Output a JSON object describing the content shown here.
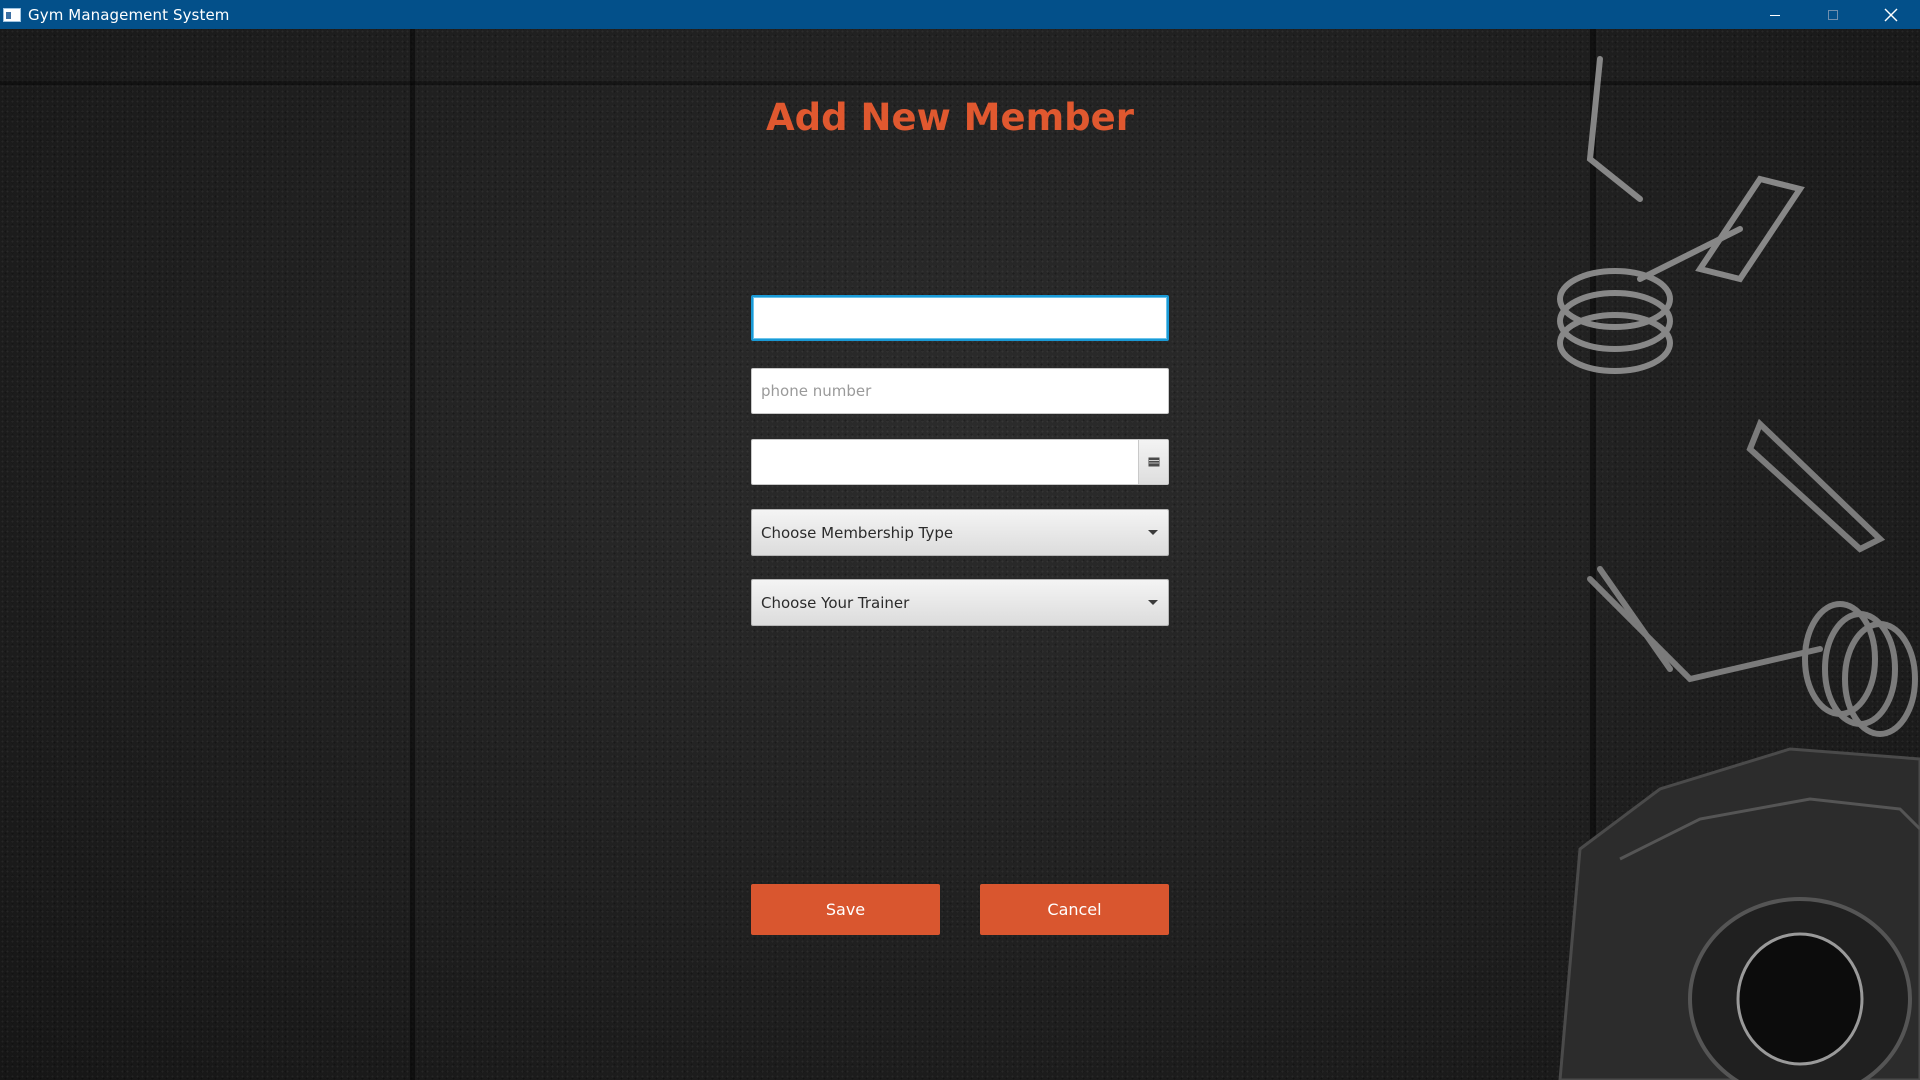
{
  "window": {
    "title": "Gym Management System"
  },
  "form": {
    "heading": "Add New Member",
    "name_field": {
      "value": "",
      "placeholder": ""
    },
    "phone_field": {
      "value": "",
      "placeholder": "phone number"
    },
    "date_field": {
      "value": "",
      "icon": "calendar-icon"
    },
    "membership_combo": {
      "selected": "Choose Membership Type"
    },
    "trainer_combo": {
      "selected": "Choose Your Trainer"
    },
    "save_label": "Save",
    "cancel_label": "Cancel"
  },
  "colors": {
    "titlebar": "#03508a",
    "accent": "#e0582f",
    "button": "#d9562f",
    "focus": "#1a9ad6"
  }
}
